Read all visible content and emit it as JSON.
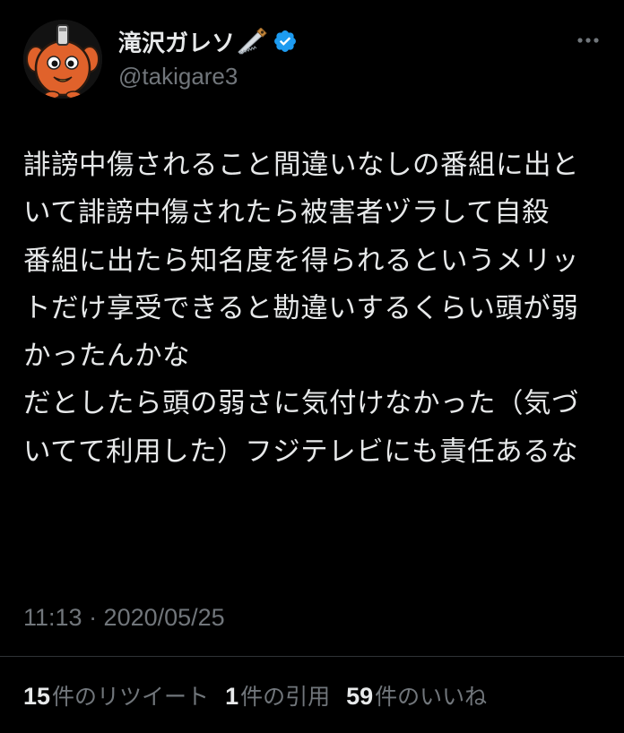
{
  "user": {
    "display_name": "滝沢ガレソ",
    "handle": "@takigare3",
    "avatar_icon": "mascot-avatar-icon",
    "name_emoji_icon": "saw-icon",
    "verified_icon": "verified-badge-icon",
    "verified_color": "#1d9bf0"
  },
  "tweet": {
    "text": "誹謗中傷されること間違いなしの番組に出といて誹謗中傷されたら被害者ヅラして自殺\n番組に出たら知名度を得られるというメリットだけ享受できると勘違いするくらい頭が弱かったんかな\nだとしたら頭の弱さに気付けなかった（気づいてて利用した）フジテレビにも責任あるな",
    "time": "11:13 · 2020/05/25"
  },
  "stats": [
    {
      "count": "15",
      "label": "件のリツイート"
    },
    {
      "count": "1",
      "label": "件の引用"
    },
    {
      "count": "59",
      "label": "件のいいね"
    }
  ],
  "menu": {
    "more_icon": "more-options-icon"
  },
  "colors": {
    "background": "#000000",
    "primary_text": "#e7e9ea",
    "secondary_text": "#71767b",
    "divider": "#2f3336",
    "avatar_orange": "#e0622b"
  }
}
